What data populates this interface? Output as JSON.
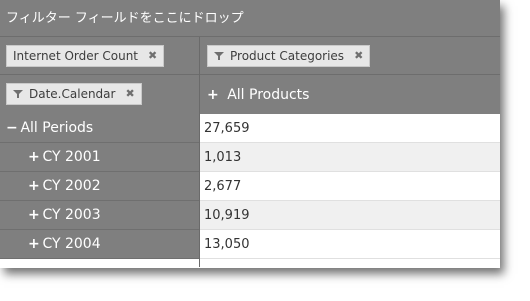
{
  "filter_area": {
    "placeholder": "フィルター フィールドをここにドロップ"
  },
  "chips": {
    "measure": {
      "label": "Internet Order Count",
      "remove_glyph": "✖"
    },
    "column_field": {
      "label": "Product Categories",
      "remove_glyph": "✖"
    },
    "row_field": {
      "label": "Date.Calendar",
      "remove_glyph": "✖"
    }
  },
  "column_header": {
    "expand_glyph": "+",
    "label": "All Products"
  },
  "rows": [
    {
      "expand_glyph": "−",
      "label": "All Periods",
      "value": "27,659"
    },
    {
      "expand_glyph": "+",
      "label": "CY 2001",
      "value": "1,013"
    },
    {
      "expand_glyph": "+",
      "label": "CY 2002",
      "value": "2,677"
    },
    {
      "expand_glyph": "+",
      "label": "CY 2003",
      "value": "10,919"
    },
    {
      "expand_glyph": "+",
      "label": "CY 2004",
      "value": "13,050"
    }
  ],
  "colors": {
    "header_gray": "#7f7f7f",
    "chip_bg": "#e7e7e7",
    "alt_row": "#f0f0f0"
  }
}
